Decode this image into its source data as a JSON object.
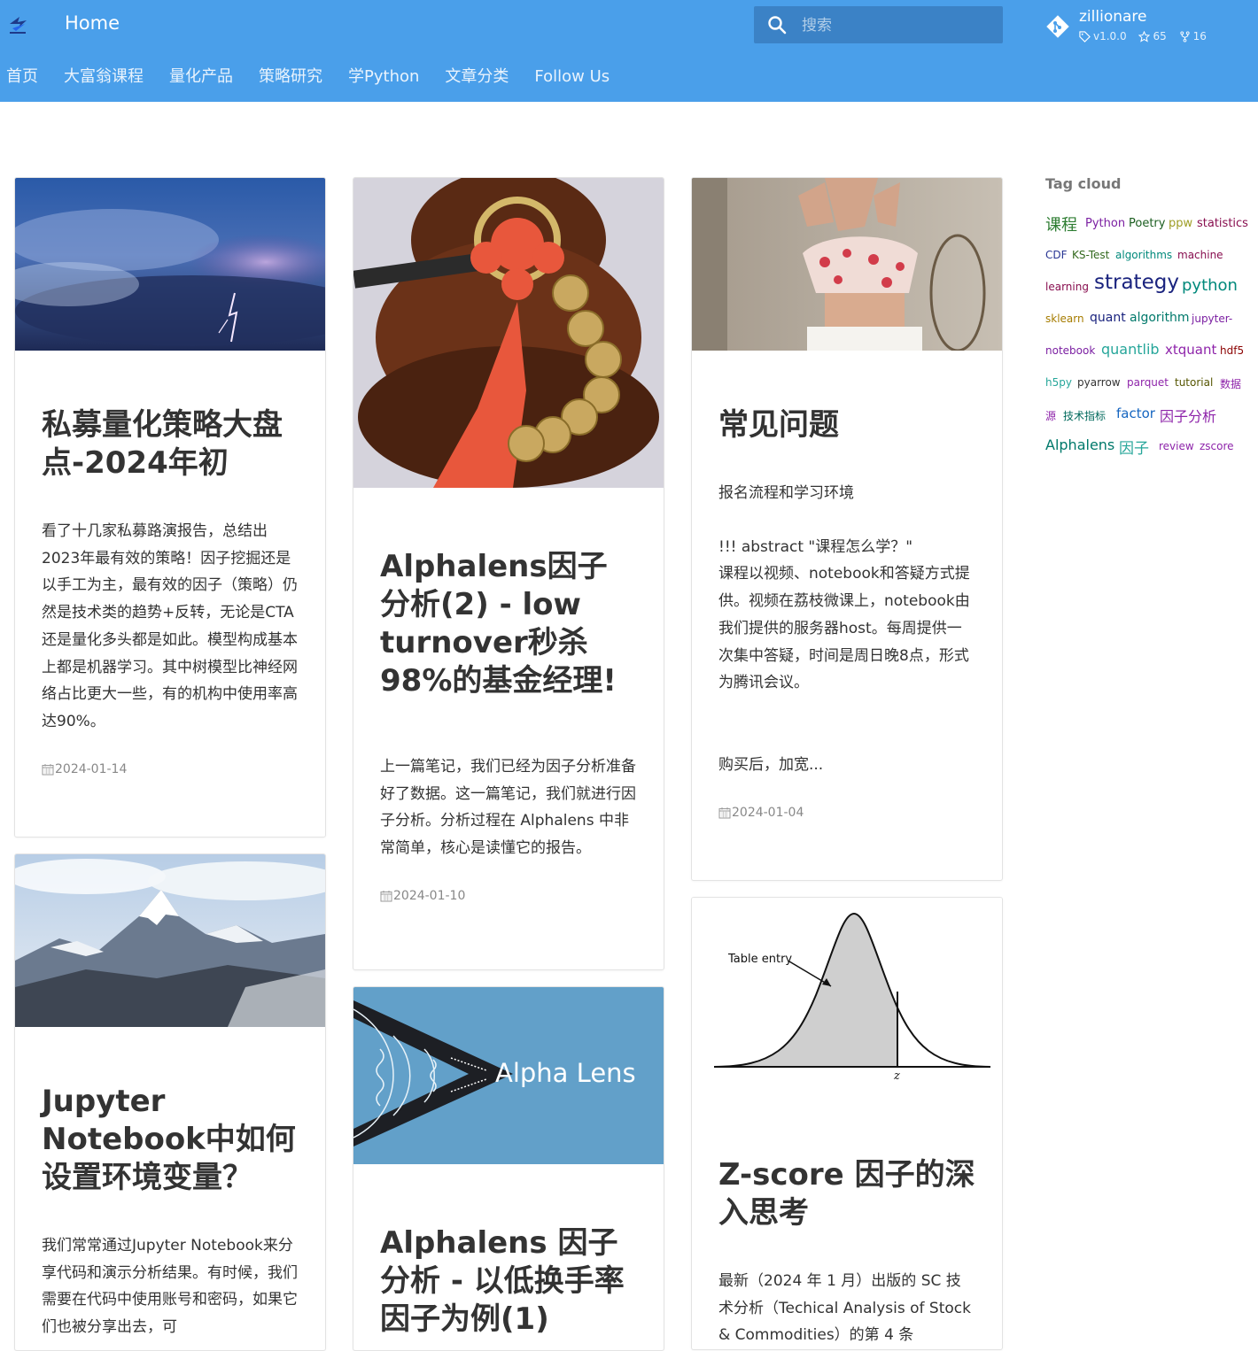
{
  "header": {
    "site_title": "Home",
    "search_placeholder": "搜索",
    "repo": {
      "name": "zillionare",
      "version": "v1.0.0",
      "stars": "65",
      "forks": "16"
    }
  },
  "nav_tabs": [
    {
      "label": "首页"
    },
    {
      "label": "大富翁课程"
    },
    {
      "label": "量化产品"
    },
    {
      "label": "策略研究"
    },
    {
      "label": "学Python"
    },
    {
      "label": "文章分类"
    },
    {
      "label": "Follow Us"
    }
  ],
  "posts": [
    {
      "title": "私募量化策略大盘点-2024年初",
      "excerpt": "看了十几家私募路演报告，总结出2023年最有效的策略！因子挖掘还是以手工为主，最有效的因子（策略）仍然是技术类的趋势+反转，无论是CTA还是量化多头都是如此。模型构成基本上都是机器学习。其中树模型比神经网络占比更大一些，有的机构中使用率高达90%。",
      "date": "2024-01-14"
    },
    {
      "title": "Alphalens因子分析(2) - low turnover秒杀98%的基金经理!",
      "excerpt": "上一篇笔记，我们已经为因子分析准备好了数据。这一篇笔记，我们就进行因子分析。分析过程在 Alphalens 中非常简单，核心是读懂它的报告。",
      "date": "2024-01-10"
    },
    {
      "title": "常见问题",
      "excerpt_lines": [
        "报名流程和学习环境",
        "!!! abstract \"课程怎么学？\"",
        "课程以视频、notebook和答疑方式提供。视频在荔枝微课上，notebook由我们提供的服务器host。每周提供一次集中答疑，时间是周日晚8点，形式为腾讯会议。",
        "购买后，加宽..."
      ],
      "date": "2024-01-04"
    },
    {
      "title": "Jupyter Notebook中如何设置环境变量？",
      "excerpt": "我们常常通过Jupyter Notebook来分享代码和演示分析结果。有时候，我们需要在代码中使用账号和密码，如果它们也被分享出去，可"
    },
    {
      "title": "Alphalens 因子分析 - 以低换手率因子为例(1)",
      "image_text": "Alpha Lens"
    },
    {
      "title": "Z-score 因子的深入思考",
      "excerpt": "最新（2024 年 1 月）出版的 SC 技术分析（Techical Analysis of Stock & Commodities）的第 4 条",
      "image_labels": {
        "entry": "Table entry",
        "z": "z"
      }
    }
  ],
  "tag_cloud": {
    "title": "Tag cloud",
    "tags": [
      {
        "label": "课程",
        "color": "#2e7d32"
      },
      {
        "label": "Python",
        "color": "#7b1fa2"
      },
      {
        "label": "Poetry",
        "color": "#1b5e20"
      },
      {
        "label": "ppw",
        "color": "#9e9d24"
      },
      {
        "label": "statistics",
        "color": "#880e4f"
      },
      {
        "label": "CDF",
        "color": "#283593"
      },
      {
        "label": "KS-Test",
        "color": "#33691e"
      },
      {
        "label": "algorithms",
        "color": "#00897b"
      },
      {
        "label": "machine",
        "color": "#880e4f"
      },
      {
        "label": "learning",
        "color": "#880e4f"
      },
      {
        "label": "strategy",
        "color": "#1a237e"
      },
      {
        "label": "python",
        "color": "#00897b"
      },
      {
        "label": "sklearn",
        "color": "#a67c00"
      },
      {
        "label": "quant",
        "color": "#1a237e"
      },
      {
        "label": "algorithm",
        "color": "#00796b"
      },
      {
        "label": "jupyter-",
        "color": "#7b1fa2"
      },
      {
        "label": "notebook",
        "color": "#7b1fa2"
      },
      {
        "label": "quantlib",
        "color": "#26a69a"
      },
      {
        "label": "xtquant",
        "color": "#8e24aa"
      },
      {
        "label": "hdf5",
        "color": "#8b0000"
      },
      {
        "label": "h5py",
        "color": "#26a69a"
      },
      {
        "label": "pyarrow",
        "color": "#333333"
      },
      {
        "label": "parquet",
        "color": "#8e24aa"
      },
      {
        "label": "tutorial",
        "color": "#555500"
      },
      {
        "label": "数据",
        "color": "#8e24aa"
      },
      {
        "label": "源",
        "color": "#8e24aa"
      },
      {
        "label": "技术指标",
        "color": "#00695c"
      },
      {
        "label": "factor",
        "color": "#1565c0"
      },
      {
        "label": "因子分析",
        "color": "#8e24aa"
      },
      {
        "label": "Alphalens",
        "color": "#00796b"
      },
      {
        "label": "因子",
        "color": "#26a69a"
      },
      {
        "label": "review",
        "color": "#8e24aa"
      },
      {
        "label": "zscore",
        "color": "#8e24aa"
      }
    ]
  }
}
